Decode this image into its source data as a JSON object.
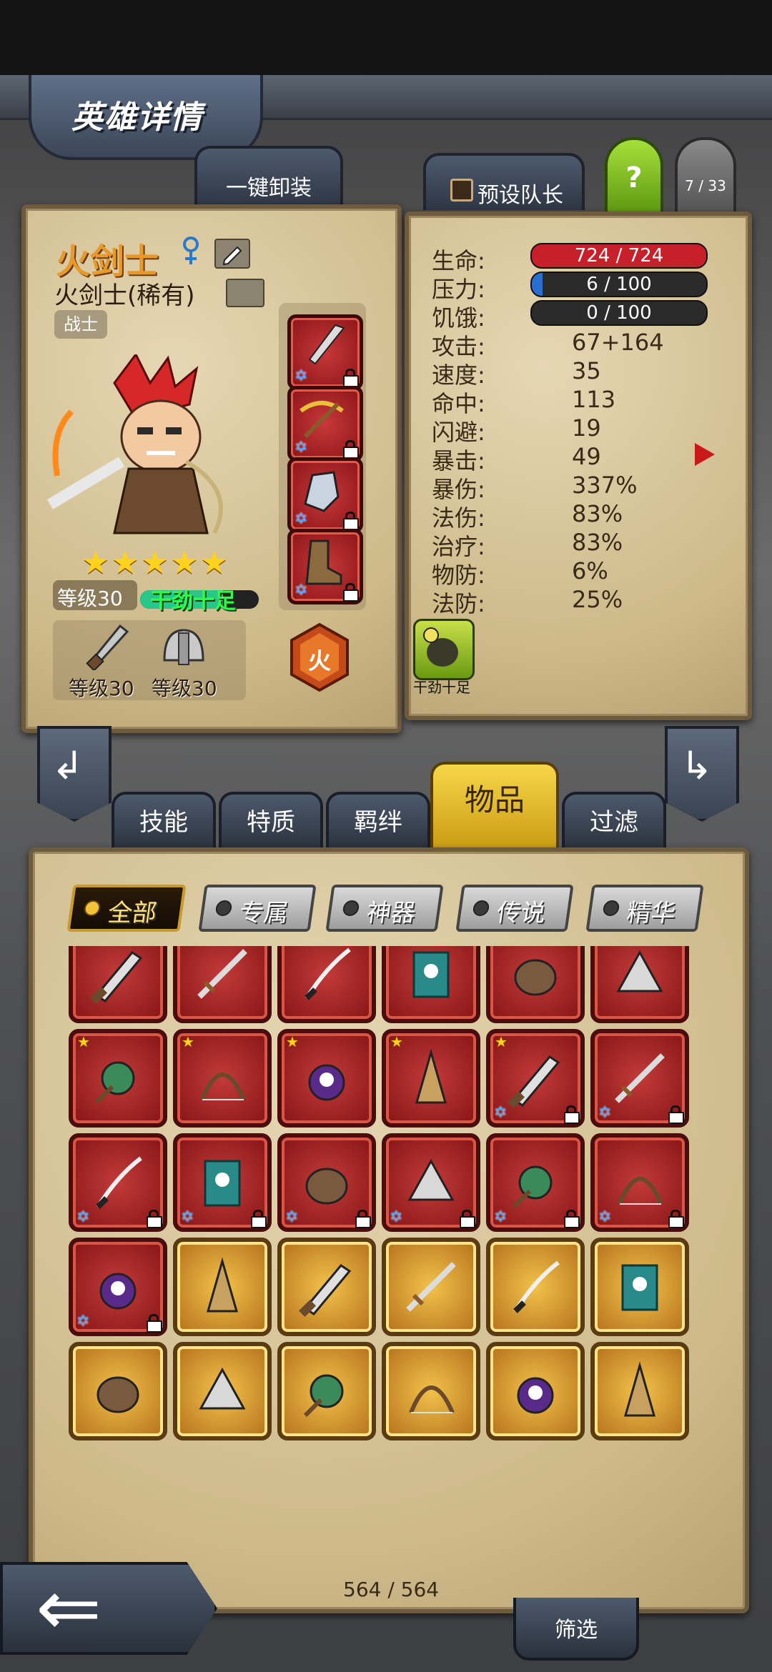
{
  "header": {
    "title": "英雄详情"
  },
  "top_buttons": {
    "unequip_all": "一键卸装",
    "preset_leader": "预设队长",
    "help": "?",
    "hero_counter": "7 / 33"
  },
  "hero": {
    "name": "火剑士",
    "class_rarity": "火剑士(稀有)",
    "role_tag": "战士",
    "stars": 5,
    "level_label": "等级30",
    "mood_label": "干劲十足",
    "weapon_level": "等级30",
    "armor_level": "等级30",
    "element_label": "火",
    "trait_badge_label": "干劲十足"
  },
  "stats": {
    "hp": {
      "label": "生命:",
      "value": "724 / 724",
      "fraction": 1.0
    },
    "stress": {
      "label": "压力:",
      "value": "6 / 100",
      "fraction": 0.06
    },
    "hunger": {
      "label": "饥饿:",
      "value": "0 / 100",
      "fraction": 0.0
    },
    "rows": [
      {
        "label": "攻击:",
        "value": "67+164"
      },
      {
        "label": "速度:",
        "value": "35"
      },
      {
        "label": "命中:",
        "value": "113"
      },
      {
        "label": "闪避:",
        "value": "19"
      },
      {
        "label": "暴击:",
        "value": "49"
      },
      {
        "label": "暴伤:",
        "value": "337%"
      },
      {
        "label": "法伤:",
        "value": "83%"
      },
      {
        "label": "治疗:",
        "value": "83%"
      },
      {
        "label": "物防:",
        "value": "6%"
      },
      {
        "label": "法防:",
        "value": "25%"
      }
    ]
  },
  "tabs": [
    {
      "label": "技能"
    },
    {
      "label": "特质"
    },
    {
      "label": "羁绊"
    },
    {
      "label": "物品",
      "active": true
    },
    {
      "label": "过滤"
    }
  ],
  "categories": [
    "全部",
    "专属",
    "神器",
    "传说",
    "精华"
  ],
  "inventory": {
    "counter": "564 / 564",
    "filter_button": "筛选"
  },
  "colors": {
    "hp_bar": "#c8202a",
    "stress_bar": "#2a6fd0",
    "active_tab": "#f1c21a",
    "mood_bar": "#29c68a"
  },
  "equip_slots": [
    "spear-tip-icon",
    "golden-crossbow-icon",
    "gauntlet-icon",
    "boot-icon"
  ],
  "grid_rows": [
    [
      "red-star",
      "red-star",
      "red-star",
      "red-star",
      "red-star",
      "red-star"
    ],
    [
      "red-star",
      "red-star",
      "red-star",
      "red-star",
      "red-star-lock",
      "red-lock"
    ],
    [
      "red-lock",
      "red-lock",
      "red-lock",
      "red-lock",
      "red-lock",
      "red-lock"
    ],
    [
      "red-lock",
      "gold",
      "gold",
      "gold",
      "gold",
      "gold"
    ],
    [
      "gold",
      "gold",
      "gold",
      "gold",
      "gold",
      "gold"
    ]
  ]
}
